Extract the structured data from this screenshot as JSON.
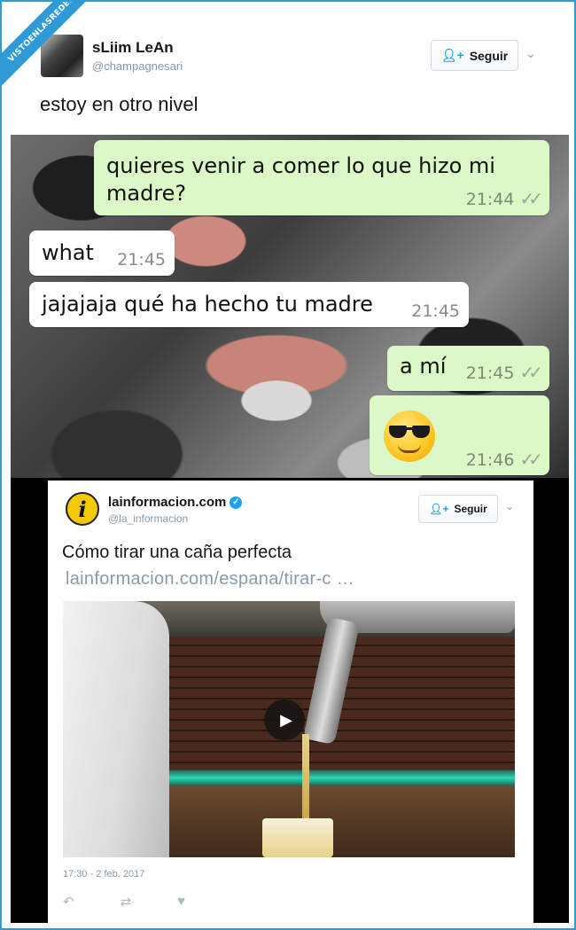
{
  "watermark": "VISTOENLASREDES",
  "tweet1": {
    "display_name": "sLiim LeAn",
    "handle": "@champagnesari",
    "follow_label": "Seguir",
    "text": "estoy en otro nivel"
  },
  "chat": {
    "messages": [
      {
        "direction": "out",
        "text": "quieres venir a comer lo que hizo mi madre?",
        "time": "21:44",
        "ticks": "✓✓"
      },
      {
        "direction": "in",
        "text": "what",
        "time": "21:45"
      },
      {
        "direction": "in",
        "text": "jajajaja qué ha hecho tu madre",
        "time": "21:45"
      },
      {
        "direction": "out",
        "text": "a mí",
        "time": "21:45",
        "ticks": "✓✓"
      },
      {
        "direction": "out",
        "text": "",
        "emoji": "smiling-face-with-sunglasses",
        "time": "21:46",
        "ticks": "✓✓"
      }
    ],
    "colors": {
      "outgoing": "#dcf8c6",
      "incoming": "#ffffff"
    }
  },
  "tweet2": {
    "logo_letter": "i",
    "display_name": "lainformacion.com",
    "verified": true,
    "handle": "@la_informacion",
    "follow_label": "Seguir",
    "text": "Cómo tirar una caña perfecta",
    "link": "lainformacion.com/espana/tirar-c …",
    "date": "17:30 - 2 feb. 2017",
    "actions": [
      "reply-icon",
      "retweet-icon",
      "like-icon"
    ]
  },
  "accent": "#2e9ad6"
}
